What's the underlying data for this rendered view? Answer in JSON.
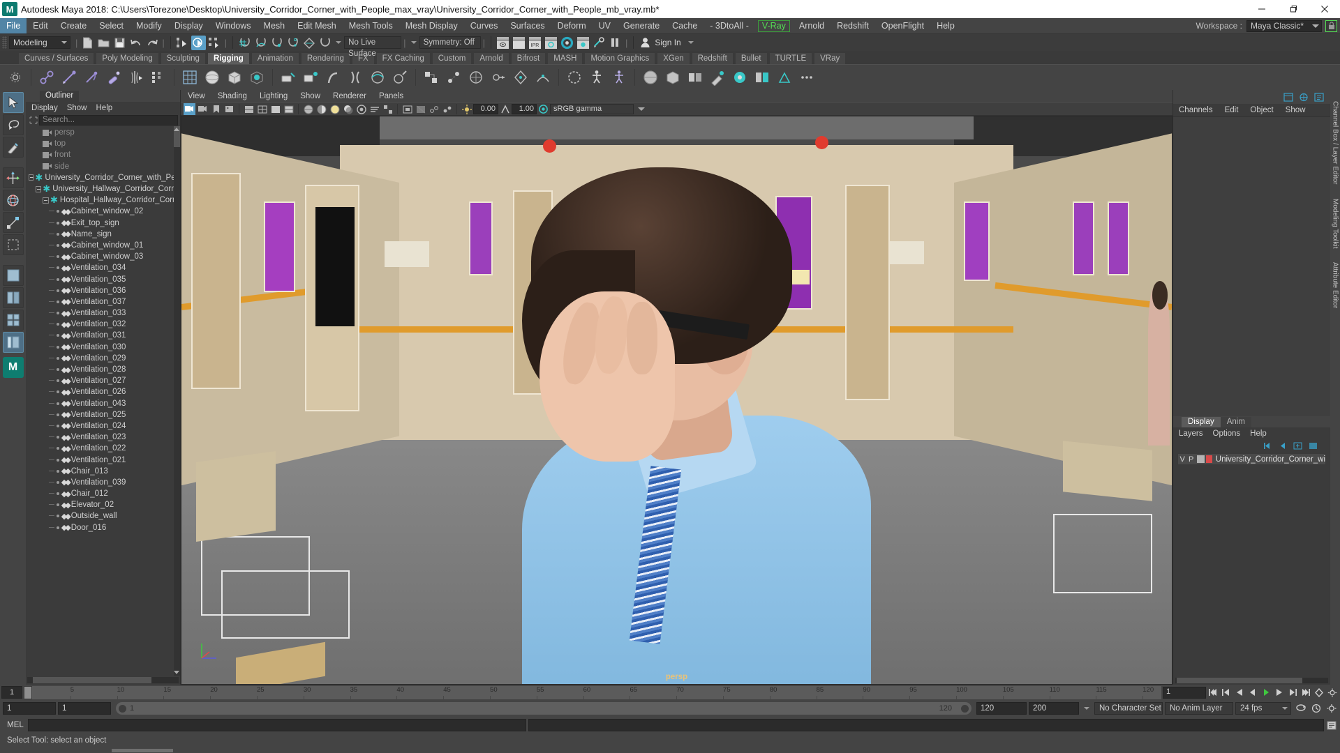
{
  "window": {
    "title": "Autodesk Maya 2018: C:\\Users\\Torezone\\Desktop\\University_Corridor_Corner_with_People_max_vray\\University_Corridor_Corner_with_People_mb_vray.mb*",
    "logo": "M",
    "minimize": "—",
    "maximize": "❐",
    "close": "✕"
  },
  "menubar": {
    "items": [
      "File",
      "Edit",
      "Create",
      "Select",
      "Modify",
      "Display",
      "Windows",
      "Mesh",
      "Edit Mesh",
      "Mesh Tools",
      "Mesh Display",
      "Curves",
      "Surfaces",
      "Deform",
      "UV",
      "Generate",
      "Cache",
      "- 3DtoAll -",
      "V-Ray",
      "Arnold",
      "Redshift",
      "OpenFlight",
      "Help"
    ],
    "active": "File",
    "highlighted": "V-Ray",
    "workspace_label": "Workspace :",
    "workspace_value": "Maya Classic*",
    "lock_icon": "lock-icon"
  },
  "statusline": {
    "mode": "Modeling",
    "no_live_surface": "No Live Surface",
    "symmetry": "Symmetry: Off",
    "signin": "Sign In",
    "ipr_label": "IPR"
  },
  "shelf": {
    "tabs": [
      "Curves / Surfaces",
      "Poly Modeling",
      "Sculpting",
      "Rigging",
      "Animation",
      "Rendering",
      "FX",
      "FX Caching",
      "Custom",
      "Arnold",
      "Bifrost",
      "MASH",
      "Motion Graphics",
      "XGen",
      "Redshift",
      "Bullet",
      "TURTLE",
      "VRay"
    ],
    "active": "Rigging"
  },
  "outliner": {
    "tab": "Outliner",
    "menus": [
      "Display",
      "Show",
      "Help"
    ],
    "search_placeholder": "Search...",
    "items": [
      {
        "label": "persp",
        "type": "camera",
        "depth": 2
      },
      {
        "label": "top",
        "type": "camera",
        "depth": 2
      },
      {
        "label": "front",
        "type": "camera",
        "depth": 2
      },
      {
        "label": "side",
        "type": "camera",
        "depth": 2
      },
      {
        "label": "University_Corridor_Corner_with_Peo",
        "type": "group",
        "depth": 0
      },
      {
        "label": "University_Hallway_Corridor_Corne",
        "type": "group",
        "depth": 1
      },
      {
        "label": "Hospital_Hallway_Corridor_Corn",
        "type": "group",
        "depth": 2
      },
      {
        "label": "Cabinet_window_02",
        "type": "mesh",
        "depth": 3
      },
      {
        "label": "Exit_top_sign",
        "type": "mesh",
        "depth": 3
      },
      {
        "label": "Name_sign",
        "type": "mesh",
        "depth": 3
      },
      {
        "label": "Cabinet_window_01",
        "type": "mesh",
        "depth": 3
      },
      {
        "label": "Cabinet_window_03",
        "type": "mesh",
        "depth": 3
      },
      {
        "label": "Ventilation_034",
        "type": "mesh",
        "depth": 3
      },
      {
        "label": "Ventilation_035",
        "type": "mesh",
        "depth": 3
      },
      {
        "label": "Ventilation_036",
        "type": "mesh",
        "depth": 3
      },
      {
        "label": "Ventilation_037",
        "type": "mesh",
        "depth": 3
      },
      {
        "label": "Ventilation_033",
        "type": "mesh",
        "depth": 3
      },
      {
        "label": "Ventilation_032",
        "type": "mesh",
        "depth": 3
      },
      {
        "label": "Ventilation_031",
        "type": "mesh",
        "depth": 3
      },
      {
        "label": "Ventilation_030",
        "type": "mesh",
        "depth": 3
      },
      {
        "label": "Ventilation_029",
        "type": "mesh",
        "depth": 3
      },
      {
        "label": "Ventilation_028",
        "type": "mesh",
        "depth": 3
      },
      {
        "label": "Ventilation_027",
        "type": "mesh",
        "depth": 3
      },
      {
        "label": "Ventilation_026",
        "type": "mesh",
        "depth": 3
      },
      {
        "label": "Ventilation_043",
        "type": "mesh",
        "depth": 3
      },
      {
        "label": "Ventilation_025",
        "type": "mesh",
        "depth": 3
      },
      {
        "label": "Ventilation_024",
        "type": "mesh",
        "depth": 3
      },
      {
        "label": "Ventilation_023",
        "type": "mesh",
        "depth": 3
      },
      {
        "label": "Ventilation_022",
        "type": "mesh",
        "depth": 3
      },
      {
        "label": "Ventilation_021",
        "type": "mesh",
        "depth": 3
      },
      {
        "label": "Chair_013",
        "type": "mesh",
        "depth": 3
      },
      {
        "label": "Ventilation_039",
        "type": "mesh",
        "depth": 3
      },
      {
        "label": "Chair_012",
        "type": "mesh",
        "depth": 3
      },
      {
        "label": "Elevator_02",
        "type": "mesh",
        "depth": 3
      },
      {
        "label": "Outside_wall",
        "type": "mesh",
        "depth": 3
      },
      {
        "label": "Door_016",
        "type": "mesh",
        "depth": 3
      }
    ]
  },
  "viewport": {
    "menus": [
      "View",
      "Shading",
      "Lighting",
      "Show",
      "Renderer",
      "Panels"
    ],
    "exposure": "0.00",
    "gamma_value": "1.00",
    "color_profile": "sRGB gamma",
    "camera_label": "persp"
  },
  "channelbox": {
    "menus": [
      "Channels",
      "Edit",
      "Object",
      "Show"
    ]
  },
  "layers": {
    "tabs": [
      "Display",
      "Anim"
    ],
    "active_tab": "Display",
    "menus": [
      "Layers",
      "Options",
      "Help"
    ],
    "rows": [
      {
        "v": "V",
        "p": "P",
        "color": "#d84a4a",
        "name": "University_Corridor_Corner_wi"
      }
    ]
  },
  "vertical_tabs": [
    "Channel Box / Layer Editor",
    "Modeling Toolkit",
    "Attribute Editor"
  ],
  "timeslider": {
    "current_frame": "1",
    "ticks": [
      "5",
      "10",
      "15",
      "20",
      "25",
      "30",
      "35",
      "40",
      "45",
      "50",
      "55",
      "60",
      "65",
      "70",
      "75",
      "80",
      "85",
      "90",
      "95",
      "100",
      "105",
      "110",
      "115",
      "120"
    ],
    "frame_field": "1"
  },
  "rangeslider": {
    "anim_start": "1",
    "range_start": "1",
    "range_track_start": "1",
    "range_track_end": "120",
    "range_end": "120",
    "anim_end": "200",
    "character_set": "No Character Set",
    "anim_layer": "No Anim Layer",
    "fps": "24 fps"
  },
  "mel": {
    "label": "MEL",
    "input": "",
    "output": ""
  },
  "helpline": {
    "text": "Select Tool: select an object"
  },
  "colors": {
    "accent": "#5aa0c8",
    "vray_green": "#55dd55",
    "teal": "#39c8c8",
    "layer_red": "#d84a4a",
    "timeslider": "#5b5b5b"
  }
}
